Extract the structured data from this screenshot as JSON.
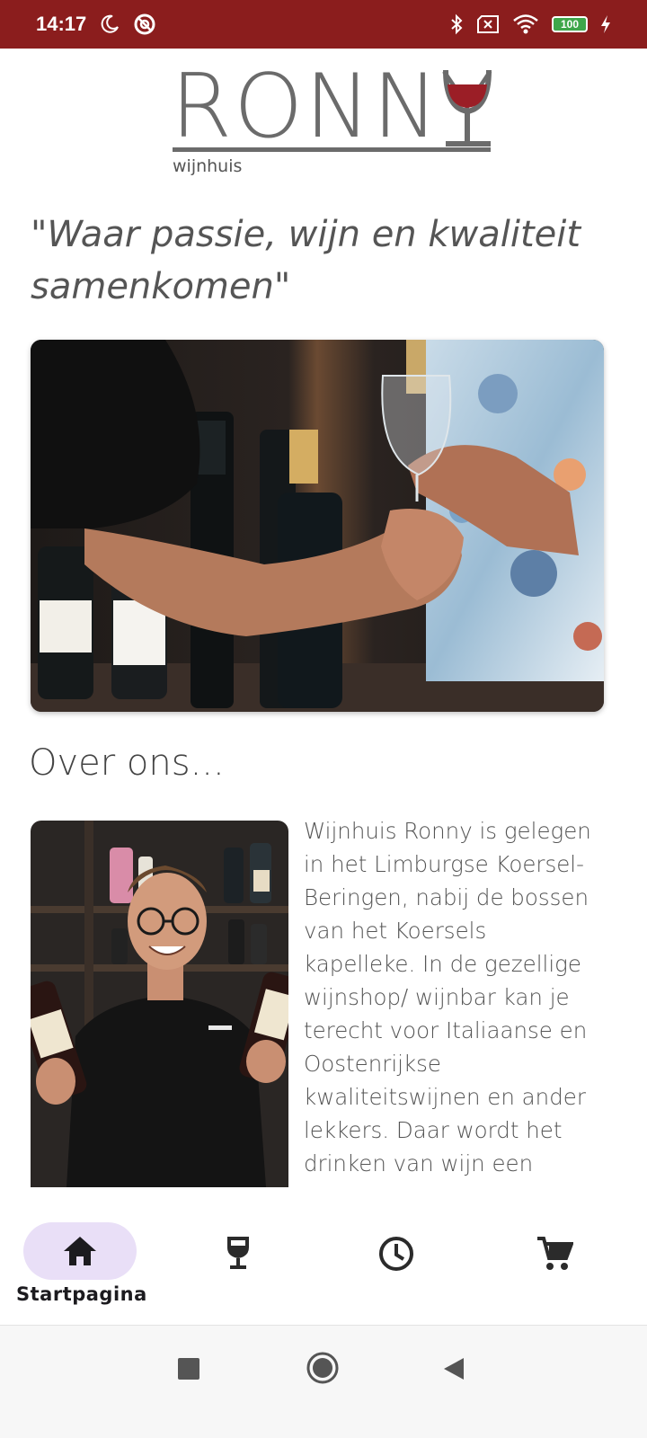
{
  "status_bar": {
    "time": "14:17",
    "battery": "100",
    "icons": [
      "moon-icon",
      "data-saver-icon",
      "bluetooth-icon",
      "no-sim-icon",
      "wifi-icon",
      "battery-icon",
      "charging-icon"
    ]
  },
  "logo": {
    "word": "RONNY",
    "subtitle": "wijnhuis"
  },
  "quote": "\"Waar passie, wijn en kwaliteit samenkomen\"",
  "section": {
    "title": "Over ons..."
  },
  "about_text": "Wijnhuis Ronny is gelegen in het Limburgse Koersel-Beringen, nabij de bossen van het Koersels kapelleke. In de gezellige wijnshop/ wijnbar kan je terecht voor Italiaanse en Oostenrijkse kwaliteitswijnen en ander lekkers. Daar wordt het drinken van wijn een",
  "bottom_nav": {
    "items": [
      {
        "icon": "home-icon",
        "label": "Startpagina",
        "active": true
      },
      {
        "icon": "wine-glass-icon",
        "label": "",
        "active": false
      },
      {
        "icon": "clock-icon",
        "label": "",
        "active": false
      },
      {
        "icon": "cart-icon",
        "label": "",
        "active": false
      }
    ]
  },
  "colors": {
    "status_bar": "#8b1d1d",
    "wine": "#9b1e26",
    "nav_active_pill": "#e9dff7",
    "battery": "#3ea64a"
  }
}
